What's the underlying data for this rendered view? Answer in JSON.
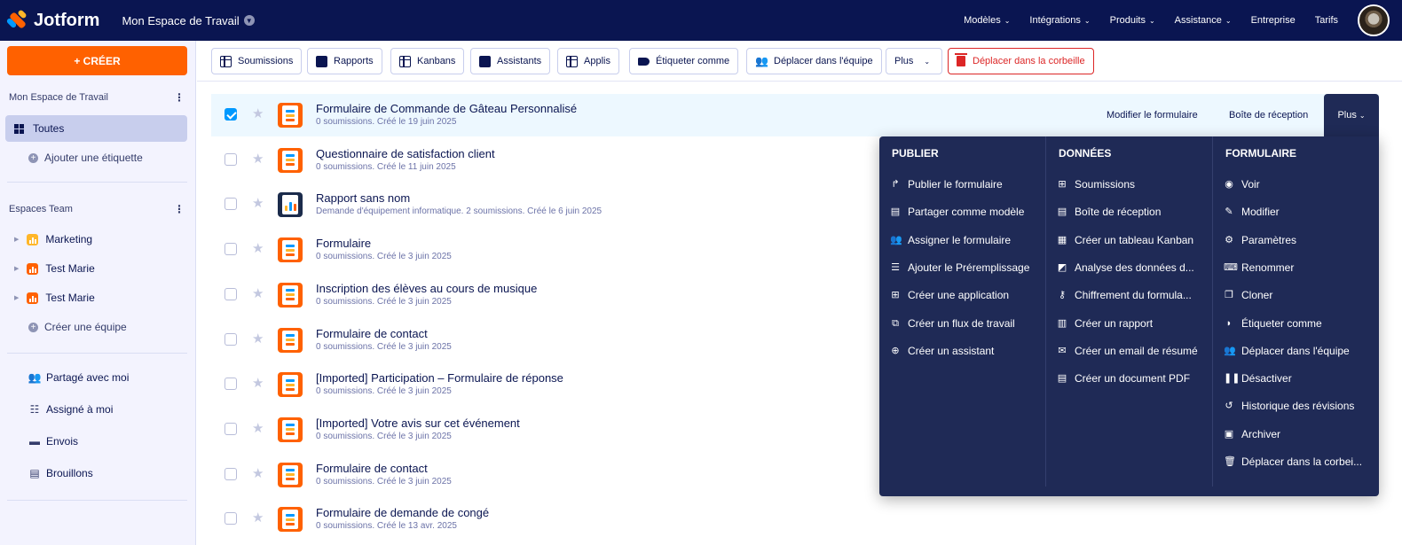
{
  "app": {
    "logo": "Jotform",
    "workspace": "Mon Espace de Travail"
  },
  "nav": [
    {
      "label": "Modèles",
      "chevron": true
    },
    {
      "label": "Intégrations",
      "chevron": true
    },
    {
      "label": "Produits",
      "chevron": true
    },
    {
      "label": "Assistance",
      "chevron": true
    },
    {
      "label": "Entreprise",
      "chevron": false
    },
    {
      "label": "Tarifs",
      "chevron": false
    }
  ],
  "sidebar": {
    "create": "+ CRÉER",
    "workspace_label": "Mon Espace de Travail",
    "all": "Toutes",
    "add_label": "Ajouter une étiquette",
    "teams_label": "Espaces Team",
    "teams": [
      {
        "name": "Marketing",
        "color": "#ffb629"
      },
      {
        "name": "Test Marie",
        "color": "#ff6100"
      },
      {
        "name": "Test Marie",
        "color": "#ff6100"
      }
    ],
    "create_team": "Créer une équipe",
    "links": [
      {
        "label": "Partagé avec moi",
        "icon": "shared-icon"
      },
      {
        "label": "Assigné à moi",
        "icon": "assigned-icon"
      },
      {
        "label": "Envois",
        "icon": "sent-icon"
      },
      {
        "label": "Brouillons",
        "icon": "drafts-icon"
      }
    ]
  },
  "toolbar": {
    "submissions": "Soumissions",
    "reports": "Rapports",
    "kanbans": "Kanbans",
    "assistants": "Assistants",
    "apps": "Applis",
    "tag": "Étiqueter comme",
    "move_team": "Déplacer dans l'équipe",
    "more": "Plus",
    "trash": "Déplacer dans la corbeille"
  },
  "forms": [
    {
      "title": "Formulaire de Commande de Gâteau Personnalisé",
      "sub": "0 soumissions. Créé le 19 juin 2025",
      "selected": true,
      "type": "form"
    },
    {
      "title": "Questionnaire de satisfaction client",
      "sub": "0 soumissions. Créé le 11 juin 2025",
      "selected": false,
      "type": "form"
    },
    {
      "title": "Rapport sans nom",
      "sub": "Demande d'équipement informatique. 2 soumissions. Créé le 6 juin 2025",
      "selected": false,
      "type": "report"
    },
    {
      "title": "Formulaire",
      "sub": "0 soumissions. Créé le 3 juin 2025",
      "selected": false,
      "type": "form"
    },
    {
      "title": "Inscription des élèves au cours de musique",
      "sub": "0 soumissions. Créé le 3 juin 2025",
      "selected": false,
      "type": "form"
    },
    {
      "title": "Formulaire de contact",
      "sub": "0 soumissions. Créé le 3 juin 2025",
      "selected": false,
      "type": "form"
    },
    {
      "title": "[Imported] Participation – Formulaire de réponse",
      "sub": "0 soumissions. Créé le 3 juin 2025",
      "selected": false,
      "type": "form"
    },
    {
      "title": "[Imported] Votre avis sur cet événement",
      "sub": "0 soumissions. Créé le 3 juin 2025",
      "selected": false,
      "type": "form"
    },
    {
      "title": "Formulaire de contact",
      "sub": "0 soumissions. Créé le 3 juin 2025",
      "selected": false,
      "type": "form"
    },
    {
      "title": "Formulaire de demande de congé",
      "sub": "0 soumissions. Créé le 13 avr. 2025",
      "selected": false,
      "type": "form"
    }
  ],
  "row_actions": {
    "edit": "Modifier le formulaire",
    "inbox": "Boîte de réception",
    "more": "Plus"
  },
  "dropdown": {
    "columns": [
      {
        "heading": "PUBLIER",
        "items": [
          {
            "label": "Publier le formulaire",
            "icon": "share-arrow-icon",
            "glyph": "↱"
          },
          {
            "label": "Partager comme modèle",
            "icon": "template-icon",
            "glyph": "▤"
          },
          {
            "label": "Assigner le formulaire",
            "icon": "assign-icon",
            "glyph": "👥"
          },
          {
            "label": "Ajouter le Préremplissage",
            "icon": "prefill-icon",
            "glyph": "☰"
          },
          {
            "label": "Créer une application",
            "icon": "app-icon",
            "glyph": "⊞"
          },
          {
            "label": "Créer un flux de travail",
            "icon": "workflow-icon",
            "glyph": "⧉"
          },
          {
            "label": "Créer un assistant",
            "icon": "plus-circle-icon",
            "glyph": "⊕"
          }
        ]
      },
      {
        "heading": "DONNÉES",
        "items": [
          {
            "label": "Soumissions",
            "icon": "table-icon",
            "glyph": "⊞"
          },
          {
            "label": "Boîte de réception",
            "icon": "inbox-icon",
            "glyph": "▤"
          },
          {
            "label": "Créer un tableau Kanban",
            "icon": "kanban-icon",
            "glyph": "▦"
          },
          {
            "label": "Analyse des données d...",
            "icon": "analytics-icon",
            "glyph": "◩"
          },
          {
            "label": "Chiffrement du formula...",
            "icon": "key-icon",
            "glyph": "⚷"
          },
          {
            "label": "Créer un rapport",
            "icon": "report-icon",
            "glyph": "▥"
          },
          {
            "label": "Créer un email de résumé",
            "icon": "email-icon",
            "glyph": "✉"
          },
          {
            "label": "Créer un document PDF",
            "icon": "pdf-icon",
            "glyph": "▤"
          }
        ]
      },
      {
        "heading": "FORMULAIRE",
        "items": [
          {
            "label": "Voir",
            "icon": "eye-icon",
            "glyph": "◉"
          },
          {
            "label": "Modifier",
            "icon": "edit-icon",
            "glyph": "✎"
          },
          {
            "label": "Paramètres",
            "icon": "gear-icon",
            "glyph": "⚙"
          },
          {
            "label": "Renommer",
            "icon": "rename-icon",
            "glyph": "⌨"
          },
          {
            "label": "Cloner",
            "icon": "clone-icon",
            "glyph": "❐"
          },
          {
            "label": "Étiqueter comme",
            "icon": "tag-icon",
            "glyph": "◗"
          },
          {
            "label": "Déplacer dans l'équipe",
            "icon": "team-move-icon",
            "glyph": "👥"
          },
          {
            "label": "Désactiver",
            "icon": "pause-icon",
            "glyph": "❚❚"
          },
          {
            "label": "Historique des révisions",
            "icon": "history-icon",
            "glyph": "↺"
          },
          {
            "label": "Archiver",
            "icon": "archive-icon",
            "glyph": "▣"
          },
          {
            "label": "Déplacer dans la corbei...",
            "icon": "trash-icon",
            "glyph": "🗑"
          }
        ]
      }
    ]
  },
  "colors": {
    "navy": "#0a1551",
    "orange": "#ff6100",
    "menu_bg": "#1f2a56",
    "danger": "#dc2626",
    "checkbox": "#0099ff"
  }
}
